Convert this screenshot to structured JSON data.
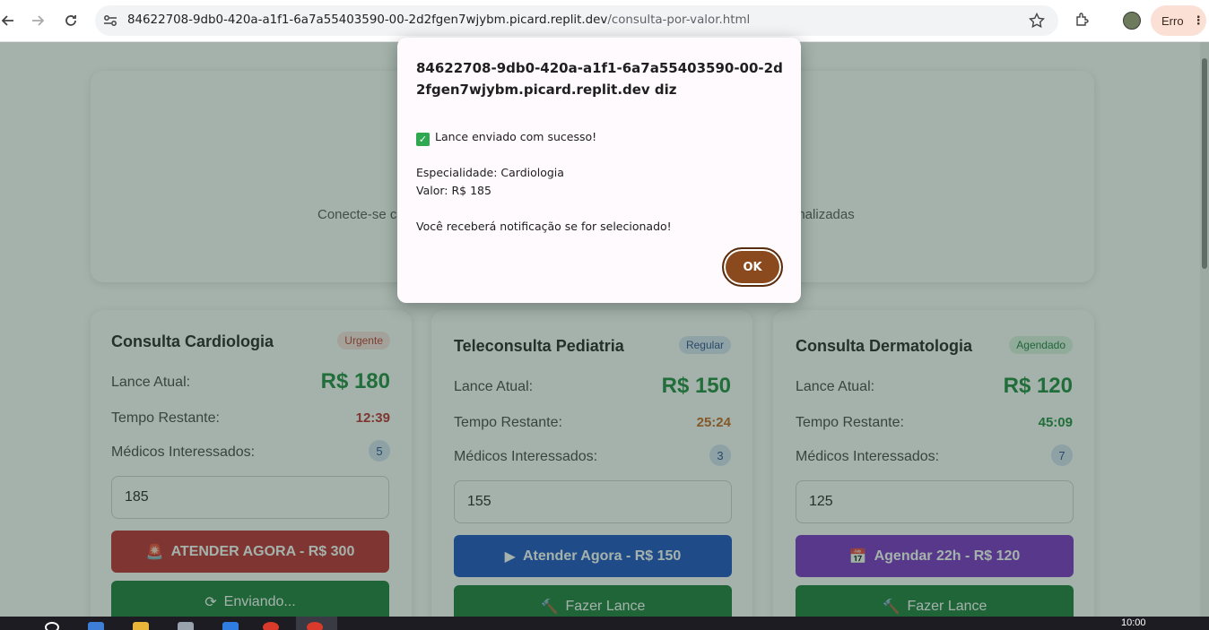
{
  "browser": {
    "url_host": "84622708-9db0-420a-a1f1-6a7a55403590-00-2d2fgen7wjybm.picard.replit.dev",
    "url_path": "/consulta-por-valor.html",
    "error_label": "Erro"
  },
  "hero": {
    "subtitle_left": "Conecte-se c",
    "subtitle_right": "onalizadas"
  },
  "cards": [
    {
      "title": "Consulta Cardiologia",
      "badge": "Urgente",
      "lance_label": "Lance Atual:",
      "price": "R$ 180",
      "tempo_label": "Tempo Restante:",
      "timer": "12:39",
      "medicos_label": "Médicos Interessados:",
      "medicos": "5",
      "input_value": "185",
      "primary_btn": "ATENDER AGORA - R$ 300",
      "secondary_btn": "Enviando..."
    },
    {
      "title": "Teleconsulta Pediatria",
      "badge": "Regular",
      "lance_label": "Lance Atual:",
      "price": "R$ 150",
      "tempo_label": "Tempo Restante:",
      "timer": "25:24",
      "medicos_label": "Médicos Interessados:",
      "medicos": "3",
      "input_value": "155",
      "primary_btn": "Atender Agora - R$ 150",
      "secondary_btn": "Fazer Lance"
    },
    {
      "title": "Consulta Dermatologia",
      "badge": "Agendado",
      "lance_label": "Lance Atual:",
      "price": "R$ 120",
      "tempo_label": "Tempo Restante:",
      "timer": "45:09",
      "medicos_label": "Médicos Interessados:",
      "medicos": "7",
      "input_value": "125",
      "primary_btn": "Agendar 22h - R$ 120",
      "secondary_btn": "Fazer Lance"
    }
  ],
  "dialog": {
    "origin": "84622708-9db0-420a-a1f1-6a7a55403590-00-2d2fgen7wjybm.picard.replit.dev diz",
    "success": "Lance enviado com sucesso!",
    "especialidade": "Especialidade: Cardiologia",
    "valor": "Valor: R$ 185",
    "notice": "Você receberá notificação se for selecionado!",
    "ok_label": "OK"
  },
  "taskbar": {
    "time": "10:00"
  },
  "colors": {
    "urgent_badge_bg": "#fde2e2",
    "urgent_badge_fg": "#c0392b",
    "regular_badge_bg": "#dbe6f8",
    "regular_badge_fg": "#2b4a8a",
    "agendado_badge_bg": "#dcf3e2",
    "agendado_badge_fg": "#1f7a3a",
    "btn_red": "#c0282d",
    "btn_blue": "#1d4fc4",
    "btn_purple": "#7b2dc8",
    "btn_green": "#1a7a3a",
    "ok_brown": "#8b4a1e"
  }
}
